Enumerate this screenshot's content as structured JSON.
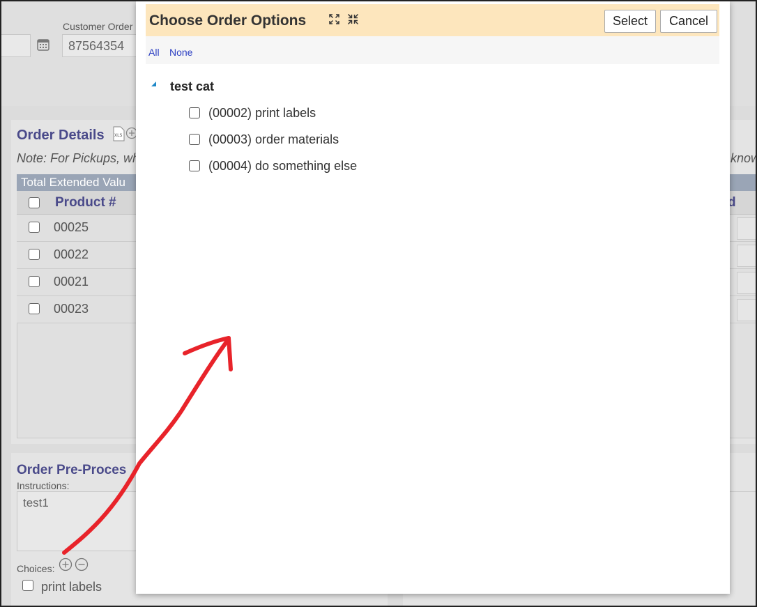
{
  "background": {
    "customer_order_label": "Customer Order",
    "customer_order_value": "87564354",
    "order_details_title": "Order Details",
    "note_text": "Note: For Pickups, wh",
    "note_text_right": "know",
    "total_extended_label": "Total Extended Valu",
    "product_header": "Product #",
    "right_header": "d",
    "rows": [
      "00025",
      "00022",
      "00021",
      "00023"
    ],
    "pre_processing_title": "Order Pre-Proces",
    "instructions_label": "Instructions:",
    "instructions_value": "test1",
    "choices_label": "Choices:",
    "print_labels": "print labels"
  },
  "modal": {
    "title": "Choose Order Options",
    "select_label": "Select",
    "cancel_label": "Cancel",
    "all_label": "All",
    "none_label": "None",
    "category": "test cat",
    "options": [
      "(00002) print labels",
      "(00003) order materials",
      "(00004) do something else"
    ]
  },
  "colors": {
    "header_bg": "#fde6bd",
    "link": "#2b3ec2",
    "section_title": "#4a4a8a",
    "annotation_arrow": "#e8232a"
  },
  "icons": [
    "calendar-icon",
    "xls-icon",
    "add-circle-icon",
    "expand-icon",
    "collapse-icon",
    "tree-expanded-arrow-icon",
    "plus-circle-icon",
    "minus-circle-icon"
  ]
}
